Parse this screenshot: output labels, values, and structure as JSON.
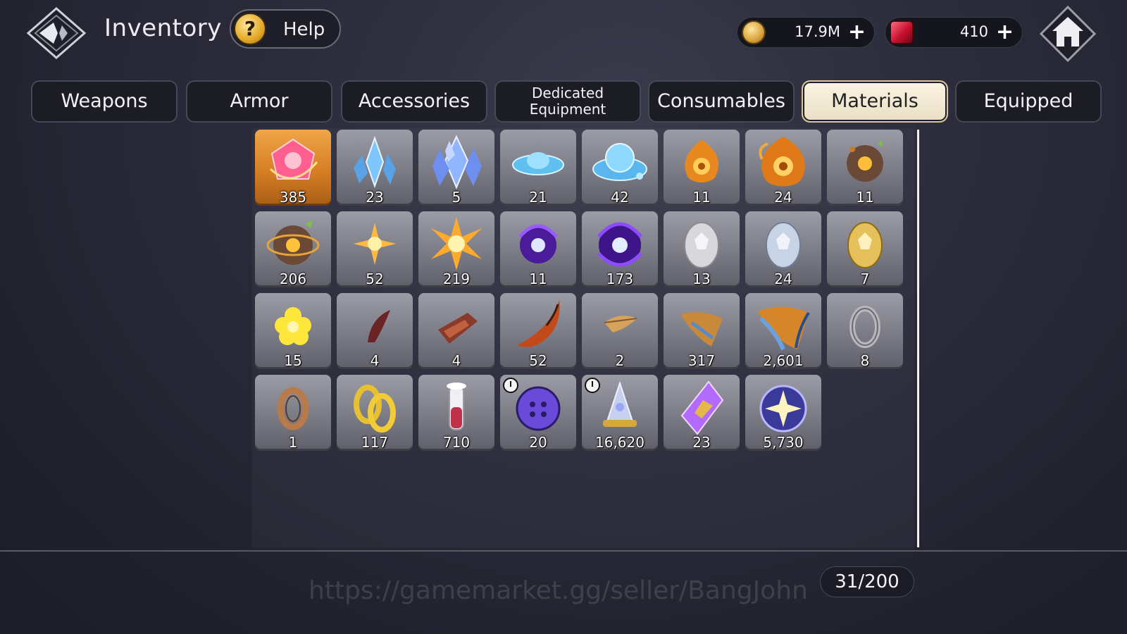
{
  "header": {
    "title": "Inventory",
    "help_label": "Help",
    "help_icon_glyph": "?",
    "back_icon": "diamond-back-icon",
    "home_icon": "home-icon"
  },
  "currencies": {
    "gold": {
      "value": "17.9M",
      "icon": "gold-coin-icon",
      "plus": "+"
    },
    "gems": {
      "value": "410",
      "icon": "red-gem-icon",
      "plus": "+"
    }
  },
  "tabs": [
    {
      "label": "Weapons"
    },
    {
      "label": "Armor"
    },
    {
      "label": "Accessories"
    },
    {
      "label": "Dedicated Equipment"
    },
    {
      "label": "Consumables"
    },
    {
      "label": "Materials",
      "active": true
    },
    {
      "label": "Equipped"
    }
  ],
  "items": [
    {
      "qty": "385",
      "icon": "pink-rose-gem-icon"
    },
    {
      "qty": "23",
      "icon": "blue-crystal-small-icon"
    },
    {
      "qty": "5",
      "icon": "blue-crystal-large-icon"
    },
    {
      "qty": "21",
      "icon": "water-orb-small-icon"
    },
    {
      "qty": "42",
      "icon": "water-orb-large-icon"
    },
    {
      "qty": "11",
      "icon": "flame-rose-small-icon"
    },
    {
      "qty": "24",
      "icon": "flame-rose-large-icon"
    },
    {
      "qty": "11",
      "icon": "fire-seed-small-icon"
    },
    {
      "qty": "206",
      "icon": "fire-seed-large-icon"
    },
    {
      "qty": "52",
      "icon": "sun-shard-small-icon"
    },
    {
      "qty": "219",
      "icon": "sun-shard-large-icon"
    },
    {
      "qty": "11",
      "icon": "void-orb-small-icon"
    },
    {
      "qty": "173",
      "icon": "void-orb-large-icon"
    },
    {
      "qty": "13",
      "icon": "silver-egg-icon"
    },
    {
      "qty": "24",
      "icon": "blue-egg-icon"
    },
    {
      "qty": "7",
      "icon": "golden-egg-icon"
    },
    {
      "qty": "15",
      "icon": "yellow-flower-icon"
    },
    {
      "qty": "4",
      "icon": "claw-small-icon"
    },
    {
      "qty": "4",
      "icon": "scale-fragment-icon"
    },
    {
      "qty": "52",
      "icon": "fang-large-icon"
    },
    {
      "qty": "2",
      "icon": "feather-small-icon"
    },
    {
      "qty": "317",
      "icon": "wing-fragment-icon"
    },
    {
      "qty": "2,601",
      "icon": "wing-large-icon"
    },
    {
      "qty": "8",
      "icon": "silver-ring-icon"
    },
    {
      "qty": "1",
      "icon": "bronze-ring-icon"
    },
    {
      "qty": "117",
      "icon": "gold-rings-icon"
    },
    {
      "qty": "710",
      "icon": "red-potion-vial-icon"
    },
    {
      "qty": "20",
      "icon": "purple-button-icon",
      "timer": true
    },
    {
      "qty": "16,620",
      "icon": "crystal-lamp-icon",
      "timer": true
    },
    {
      "qty": "23",
      "icon": "purple-crystal-shard-icon"
    },
    {
      "qty": "5,730",
      "icon": "star-orb-icon"
    }
  ],
  "footer": {
    "watermark": "https://gamemarket.gg/seller/BangJohn",
    "capacity": "31/200"
  },
  "colors": {
    "background": "#2b2b3b",
    "slot": "#7b7b86",
    "slot_highlight": "#d77e25",
    "active_tab": "#f4ecd8"
  }
}
